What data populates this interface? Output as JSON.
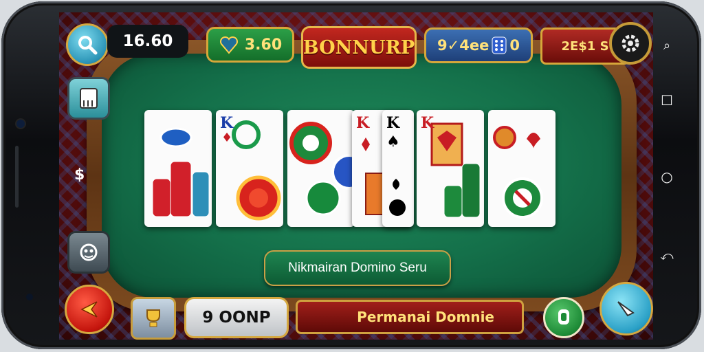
{
  "hud": {
    "coins": "16.60",
    "score": "3.60",
    "bonus_title": "BONNURP",
    "chips": "9✓4ee",
    "chips_suffix": "0",
    "rank": "2E$1 S",
    "wallet": "9 OONP",
    "table_name": "Nikmairan Domino Seru",
    "footer_title": "Permanai Domnie",
    "dollar_sign": "$"
  },
  "icons": {
    "search": "search-icon",
    "settings": "gear-icon",
    "notebook": "notebook-icon",
    "robot": "robot-icon",
    "back": "back-arrow-icon",
    "trophy": "trophy-icon",
    "green_action": "chip-icon",
    "pointer": "pointer-icon"
  },
  "cards": [
    {
      "rank": "",
      "suit": ""
    },
    {
      "rank": "K",
      "suit": "♦"
    },
    {
      "rank": "",
      "suit": ""
    },
    {
      "rank": "K",
      "suit": "♦"
    },
    {
      "rank": "K",
      "suit": "♠"
    },
    {
      "rank": "K",
      "suit": "♦"
    },
    {
      "rank": "",
      "suit": "♠"
    }
  ],
  "colors": {
    "felt": "#14704a",
    "accent_gold": "#d6a73a",
    "bonus_red": "#c2271f"
  }
}
